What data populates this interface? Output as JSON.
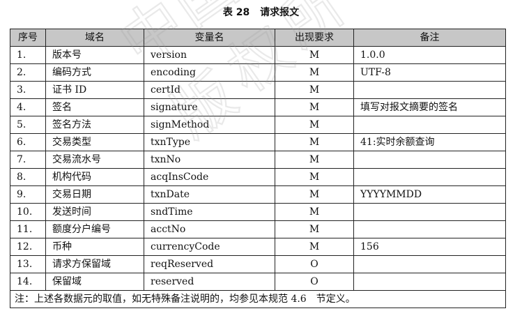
{
  "caption": {
    "number": "表 28",
    "title": "请求报文"
  },
  "headers": [
    "序号",
    "域名",
    "变量名",
    "出现要求",
    "备注"
  ],
  "rows": [
    {
      "no": "1.",
      "name": "版本号",
      "var": "version",
      "req": "M",
      "note": "1.0.0"
    },
    {
      "no": "2.",
      "name": "编码方式",
      "var": "encoding",
      "req": "M",
      "note": "UTF-8"
    },
    {
      "no": "3.",
      "name": "证书 ID",
      "var": "certId",
      "req": "M",
      "note": ""
    },
    {
      "no": "4.",
      "name": "签名",
      "var": "signature",
      "req": "M",
      "note": "填写对报文摘要的签名"
    },
    {
      "no": "5.",
      "name": "签名方法",
      "var": "signMethod",
      "req": "M",
      "note": ""
    },
    {
      "no": "6.",
      "name": "交易类型",
      "var": "txnType",
      "req": "M",
      "note": "41:实时余额查询"
    },
    {
      "no": "7.",
      "name": "交易流水号",
      "var": "txnNo",
      "req": "M",
      "note": ""
    },
    {
      "no": "8.",
      "name": "机构代码",
      "var": "acqInsCode",
      "req": "M",
      "note": ""
    },
    {
      "no": "9.",
      "name": "交易日期",
      "var": "txnDate",
      "req": "M",
      "note": "YYYYMMDD"
    },
    {
      "no": "10.",
      "name": "发送时间",
      "var": "sndTime",
      "req": "M",
      "note": ""
    },
    {
      "no": "11.",
      "name": "额度分户编号",
      "var": "acctNo",
      "req": "M",
      "note": ""
    },
    {
      "no": "12.",
      "name": "币种",
      "var": "currencyCode",
      "req": "M",
      "note": "156"
    },
    {
      "no": "13.",
      "name": "请求方保留域",
      "var": "reqReserved",
      "req": "O",
      "note": ""
    },
    {
      "no": "14.",
      "name": "保留域",
      "var": "reserved",
      "req": "O",
      "note": ""
    }
  ],
  "footnote": "注：上述各数据元的取值，如无特殊备注说明的，均参见本规范 4.6　节定义。",
  "watermark_chars": [
    "中",
    "国",
    "版",
    "权",
    "所"
  ]
}
